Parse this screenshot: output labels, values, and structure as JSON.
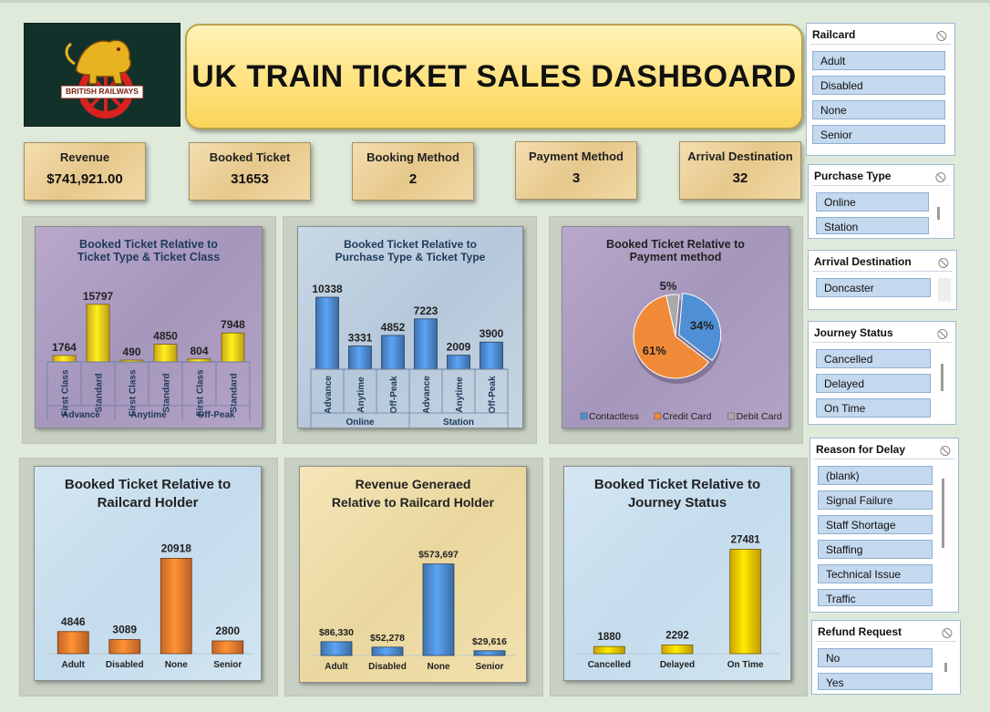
{
  "title": "UK TRAIN TICKET SALES DASHBOARD",
  "logo_text": "BRITISH RAILWAYS",
  "kpis": [
    {
      "label": "Revenue",
      "value": "$741,921.00"
    },
    {
      "label": "Booked Ticket",
      "value": "31653"
    },
    {
      "label": "Booking Method",
      "value": "2"
    },
    {
      "label": "Payment Method",
      "value": "3"
    },
    {
      "label": "Arrival Destination",
      "value": "32"
    }
  ],
  "chart_data": [
    {
      "type": "bar",
      "title_line1": "Booked Ticket Relative to",
      "title_line2": "Ticket Type & Ticket Class",
      "categories": [
        "First Class",
        "Standard",
        "First Class",
        "Standard",
        "First Class",
        "Standard"
      ],
      "groups": [
        "Advance",
        "Anytime",
        "Off-Peak"
      ],
      "values": [
        1764,
        15797,
        490,
        4850,
        804,
        7948
      ],
      "labels": [
        "1764",
        "15797",
        "490",
        "4850",
        "804",
        "7948"
      ],
      "colors": [
        "#ffd11a"
      ],
      "ylim": [
        0,
        17000
      ]
    },
    {
      "type": "bar",
      "title_line1": "Booked Ticket Relative to",
      "title_line2": "Purchase Type & Ticket Type",
      "categories": [
        "Advance",
        "Anytime",
        "Off-Peak",
        "Advance",
        "Anytime",
        "Off-Peak"
      ],
      "groups": [
        "Online",
        "Station"
      ],
      "values": [
        10338,
        3331,
        4852,
        7223,
        2009,
        3900
      ],
      "labels": [
        "10338",
        "3331",
        "4852",
        "7223",
        "2009",
        "3900"
      ],
      "colors": [
        "#4f8fd6"
      ],
      "ylim": [
        0,
        11000
      ]
    },
    {
      "type": "pie",
      "title_line1": "Booked Ticket Relative to",
      "title_line2": "Payment method",
      "slices": [
        {
          "name": "Contactless",
          "value": 34,
          "label": "34%",
          "color": "#4f8fd6"
        },
        {
          "name": "Credit Card",
          "value": 61,
          "label": "61%",
          "color": "#f08a38"
        },
        {
          "name": "Debit Card",
          "value": 5,
          "label": "5%",
          "color": "#a9a9a9"
        }
      ],
      "legend": [
        "Contactless",
        "Credit Card",
        "Debit Card"
      ]
    },
    {
      "type": "bar",
      "title_line1": "Booked Ticket Relative to",
      "title_line2": "Railcard Holder",
      "categories": [
        "Adult",
        "Disabled",
        "None",
        "Senior"
      ],
      "values": [
        4846,
        3089,
        20918,
        2800
      ],
      "labels": [
        "4846",
        "3089",
        "20918",
        "2800"
      ],
      "colors": [
        "#f47f2e"
      ],
      "ylim": [
        0,
        23000
      ]
    },
    {
      "type": "bar",
      "title_line1": "Revenue Generaed",
      "title_line2": "Relative to Railcard Holder",
      "categories": [
        "Adult",
        "Disabled",
        "None",
        "Senior"
      ],
      "values": [
        86330,
        52278,
        573697,
        29616
      ],
      "labels": [
        "$86,330",
        "$52,278",
        "$573,697",
        "$29,616"
      ],
      "colors": [
        "#4f8fd6"
      ],
      "ylim": [
        0,
        640000
      ]
    },
    {
      "type": "bar",
      "title_line1": "Booked Ticket Relative to",
      "title_line2": "Journey Status",
      "categories": [
        "Cancelled",
        "Delayed",
        "On Time"
      ],
      "values": [
        1880,
        2292,
        27481
      ],
      "labels": [
        "1880",
        "2292",
        "27481"
      ],
      "colors": [
        "#ffcc00"
      ],
      "ylim": [
        0,
        30000
      ]
    }
  ],
  "slicers": [
    {
      "header": "Railcard",
      "items": [
        "Adult",
        "Disabled",
        "None",
        "Senior"
      ]
    },
    {
      "header": "Purchase Type",
      "items": [
        "Online",
        "Station"
      ]
    },
    {
      "header": "Arrival Destination",
      "items": [
        "Doncaster"
      ]
    },
    {
      "header": "Journey Status",
      "items": [
        "Cancelled",
        "Delayed",
        "On Time"
      ]
    },
    {
      "header": "Reason for Delay",
      "items": [
        "(blank)",
        "Signal Failure",
        "Staff Shortage",
        "Staffing",
        "Technical Issue",
        "Traffic"
      ]
    },
    {
      "header": "Refund Request",
      "items": [
        "No",
        "Yes"
      ]
    }
  ],
  "icons": {
    "slicer_clear": "clear-filter-icon"
  }
}
